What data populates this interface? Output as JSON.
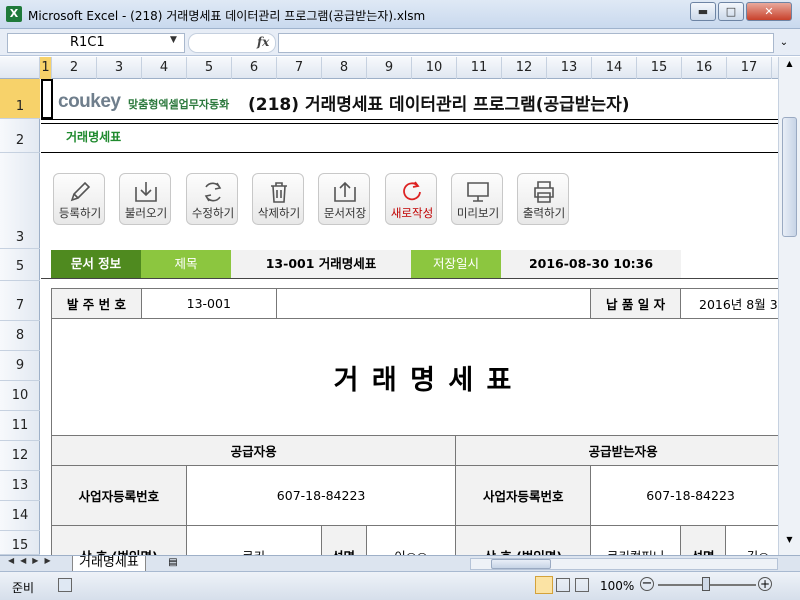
{
  "window": {
    "app_icon": "X",
    "title": "Microsoft Excel - (218) 거래명세표 데이터관리 프로그램(공급받는자).xlsm",
    "minimize": "▬",
    "maximize": "□",
    "close": "✕"
  },
  "formula_bar": {
    "name_box": "R1C1",
    "fx": "fx",
    "value": ""
  },
  "columns": [
    "1",
    "2",
    "3",
    "4",
    "5",
    "6",
    "7",
    "8",
    "9",
    "10",
    "11",
    "12",
    "13",
    "14",
    "15",
    "16",
    "17"
  ],
  "rows": [
    "1",
    "2",
    "3",
    "5",
    "7",
    "8",
    "9",
    "10",
    "11",
    "12",
    "13",
    "14",
    "15"
  ],
  "header": {
    "logo": "coukey",
    "tagline": "맞춤형엑셀업무자동화",
    "title": "(218) 거래명세표 데이터관리 프로그램(공급받는자)",
    "subtitle": "거래명세표"
  },
  "toolbar": [
    {
      "label": "등록하기",
      "icon": "pencil-icon"
    },
    {
      "label": "불러오기",
      "icon": "download-icon"
    },
    {
      "label": "수정하기",
      "icon": "refresh-icon"
    },
    {
      "label": "삭제하기",
      "icon": "trash-icon"
    },
    {
      "label": "문서저장",
      "icon": "upload-icon"
    },
    {
      "label": "새로작성",
      "icon": "new-icon"
    },
    {
      "label": "미리보기",
      "icon": "monitor-icon"
    },
    {
      "label": "출력하기",
      "icon": "printer-icon"
    }
  ],
  "info_bar": {
    "doc_info": "문서 정보",
    "subject_label": "제목",
    "subject_value": "13-001 거래명세표",
    "saved_label": "저장일시",
    "saved_value": "2016-08-30 10:36"
  },
  "form": {
    "order_no_label": "발 주 번 호",
    "order_no": "13-001",
    "delivery_date_label": "납 품 일 자",
    "delivery_date": "2016년 8월 3",
    "main_title": "거 래 명 세 표",
    "supplier_header": "공급자용",
    "receiver_header": "공급받는자용",
    "biz_no_label": "사업자등록번호",
    "supplier_biz_no": "607-18-84223",
    "receiver_biz_no": "607-18-84223",
    "company_label": "상 호 (법인명)",
    "supplier_company": "쿠키",
    "name_label": "성명",
    "supplier_name": "이○○",
    "receiver_company": "쿠키컴퍼니",
    "receiver_name": "김○"
  },
  "sheet_tabs": {
    "active": "거래명세표"
  },
  "status": {
    "ready": "준비",
    "zoom": "100%"
  },
  "colors": {
    "green_dark": "#4f8a1f",
    "green_light": "#8cc63f",
    "gray_cell": "#f2f2f2"
  }
}
